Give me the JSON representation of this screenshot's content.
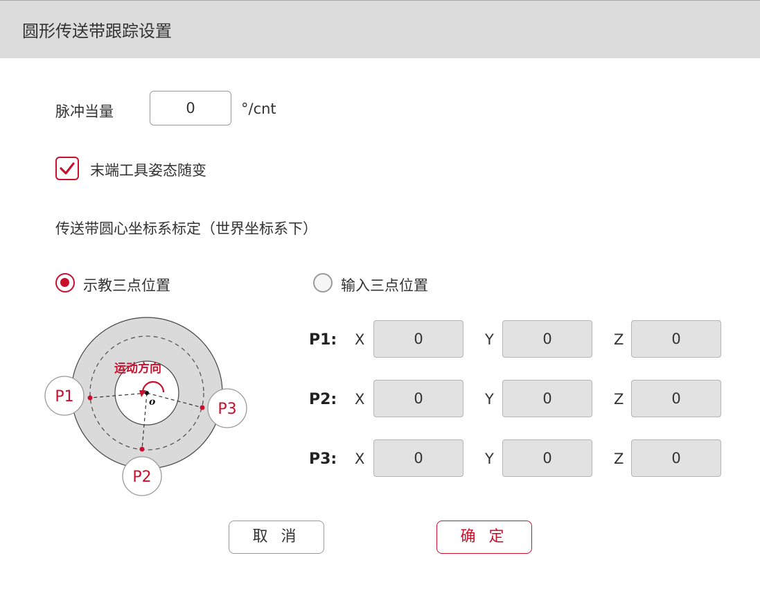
{
  "window": {
    "title": "圆形传送带跟踪设置"
  },
  "pulse": {
    "label": "脉冲当量",
    "value": "0",
    "unit": "°/cnt"
  },
  "tool_follow": {
    "label": "末端工具姿态随变",
    "checked": true
  },
  "calibration": {
    "heading": "传送带圆心坐标系标定（世界坐标系下）"
  },
  "mode": {
    "teach": {
      "label": "示教三点位置",
      "selected": true
    },
    "input": {
      "label": "输入三点位置",
      "selected": false
    }
  },
  "diagram": {
    "direction_label": "运动方向",
    "center_label": "o",
    "p1": "P1",
    "p2": "P2",
    "p3": "P3"
  },
  "points": [
    {
      "label": "P1:",
      "x_label": "X",
      "y_label": "Y",
      "z_label": "Z",
      "x": "0",
      "y": "0",
      "z": "0"
    },
    {
      "label": "P2:",
      "x_label": "X",
      "y_label": "Y",
      "z_label": "Z",
      "x": "0",
      "y": "0",
      "z": "0"
    },
    {
      "label": "P3:",
      "x_label": "X",
      "y_label": "Y",
      "z_label": "Z",
      "x": "0",
      "y": "0",
      "z": "0"
    }
  ],
  "buttons": {
    "cancel": "取 消",
    "confirm": "确 定"
  },
  "colors": {
    "accent": "#c8102e",
    "title_bg": "#dcdcdc",
    "field_bg": "#e2e2e2"
  }
}
